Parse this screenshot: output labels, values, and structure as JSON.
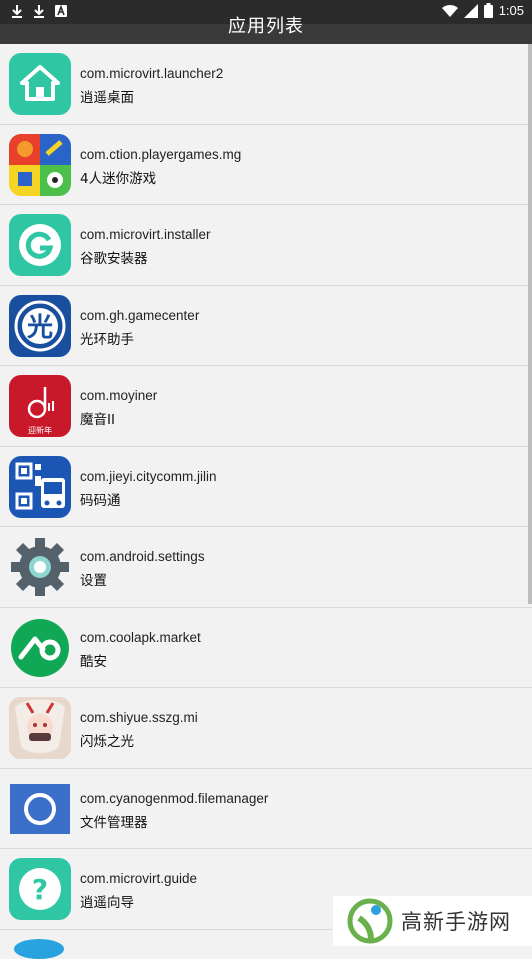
{
  "status_bar": {
    "time": "1:05"
  },
  "header": {
    "title": "应用列表"
  },
  "apps": [
    {
      "package": "com.microvirt.launcher2",
      "name": "逍遥桌面",
      "icon": "home-icon",
      "color": "#2fc7a3"
    },
    {
      "package": "com.ction.playergames.mg",
      "name": "4人迷你游戏",
      "icon": "minigames-icon",
      "color": "#f5d423"
    },
    {
      "package": "com.microvirt.installer",
      "name": "谷歌安装器",
      "icon": "g-installer-icon",
      "color": "#2fc7a3"
    },
    {
      "package": "com.gh.gamecenter",
      "name": "光环助手",
      "icon": "guang-icon",
      "color": "#1a4fa0",
      "glyph": "光"
    },
    {
      "package": "com.moyiner",
      "name": "魔音II",
      "icon": "music-icon",
      "color": "#c8182a",
      "glyph": "迎新年"
    },
    {
      "package": "com.jieyi.citycomm.jilin",
      "name": "码码通",
      "icon": "qr-bus-icon",
      "color": "#1c56b5"
    },
    {
      "package": "com.android.settings",
      "name": "设置",
      "icon": "gear-icon",
      "color": "#55616a"
    },
    {
      "package": "com.coolapk.market",
      "name": "酷安",
      "icon": "coolapk-icon",
      "color": "#11a855"
    },
    {
      "package": "com.shiyue.sszg.mi",
      "name": "闪烁之光",
      "icon": "anime-avatar-icon",
      "color": "#d88d6a"
    },
    {
      "package": "com.cyanogenmod.filemanager",
      "name": "文件管理器",
      "icon": "circle-icon",
      "color": "#3b6fc9"
    },
    {
      "package": "com.microvirt.guide",
      "name": "逍遥向导",
      "icon": "question-icon",
      "color": "#2fc7a3"
    }
  ],
  "watermark": {
    "text": "高新手游网"
  }
}
